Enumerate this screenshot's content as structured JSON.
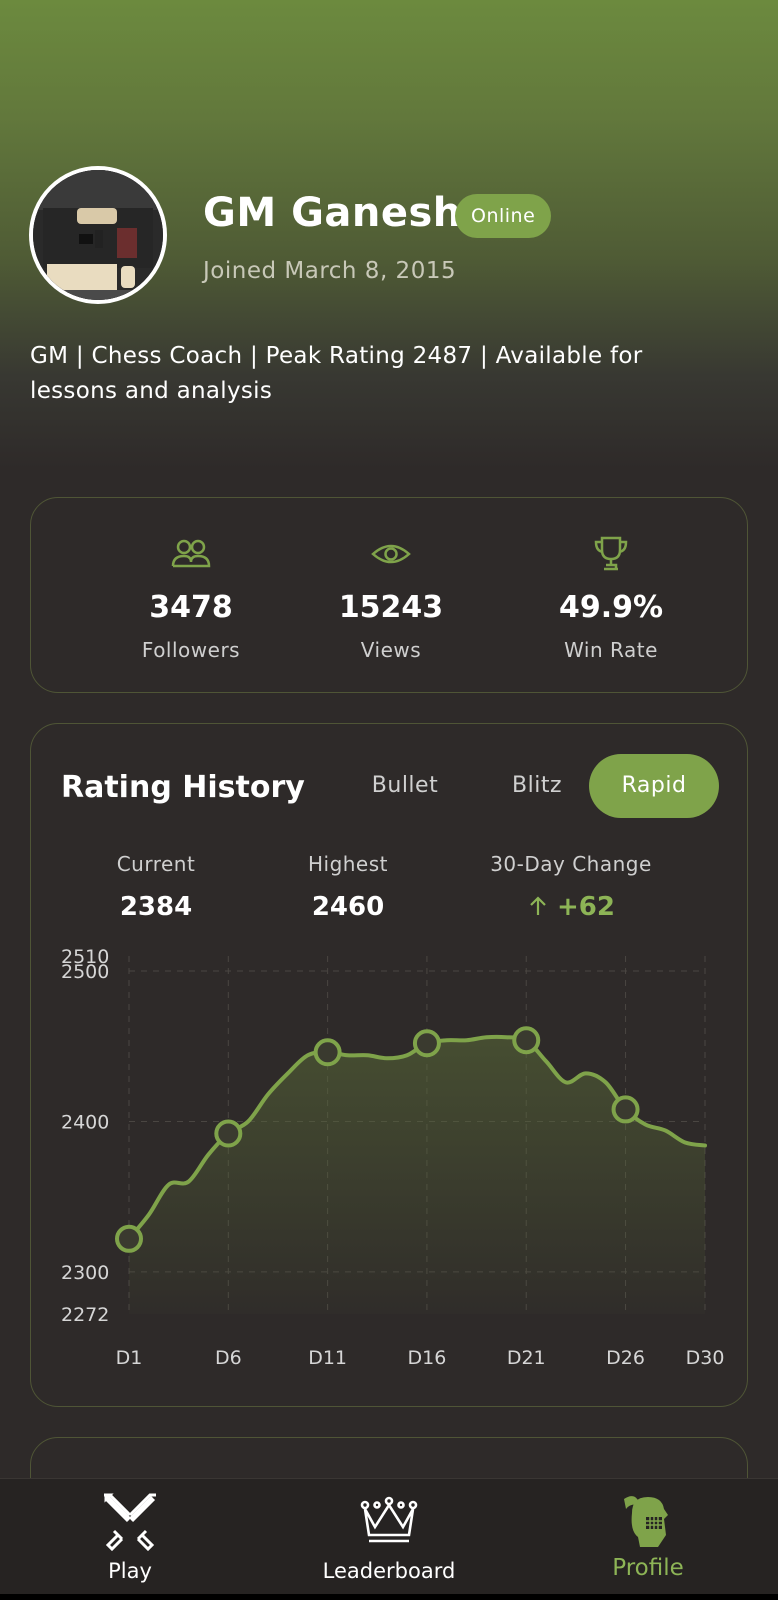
{
  "profile": {
    "name": "GM Ganesh",
    "status": "Online",
    "joined": "Joined March 8, 2015",
    "bio": "GM | Chess Coach | Peak Rating 2487 | Available for lessons and analysis"
  },
  "stats": [
    {
      "icon": "followers-icon",
      "value": "3478",
      "label": "Followers"
    },
    {
      "icon": "eye-icon",
      "value": "15243",
      "label": "Views"
    },
    {
      "icon": "trophy-icon",
      "value": "49.9%",
      "label": "Win Rate"
    }
  ],
  "rating_history": {
    "title": "Rating History",
    "tabs": [
      "Bullet",
      "Blitz",
      "Rapid"
    ],
    "active_tab": "Rapid",
    "metrics": [
      {
        "label": "Current",
        "value": "2384"
      },
      {
        "label": "Highest",
        "value": "2460"
      },
      {
        "label": "30-Day Change",
        "value": "+62"
      }
    ]
  },
  "chart_data": {
    "type": "area",
    "x": [
      "D1",
      "D2",
      "D3",
      "D4",
      "D5",
      "D6",
      "D7",
      "D8",
      "D9",
      "D10",
      "D11",
      "D12",
      "D13",
      "D14",
      "D15",
      "D16",
      "D17",
      "D18",
      "D19",
      "D20",
      "D21",
      "D22",
      "D23",
      "D24",
      "D25",
      "D26",
      "D27",
      "D28",
      "D29",
      "D30"
    ],
    "values": [
      2322,
      2338,
      2358,
      2360,
      2378,
      2392,
      2400,
      2418,
      2432,
      2444,
      2446,
      2444,
      2444,
      2442,
      2444,
      2452,
      2454,
      2454,
      2456,
      2456,
      2454,
      2440,
      2426,
      2432,
      2426,
      2408,
      2398,
      2394,
      2386,
      2384
    ],
    "markers": [
      "D1",
      "D6",
      "D11",
      "D16",
      "D21",
      "D26"
    ],
    "xtick_labels": [
      "D1",
      "D6",
      "D11",
      "D16",
      "D21",
      "D26",
      "D30"
    ],
    "ytick_labels": [
      "2510",
      "2500",
      "2400",
      "2300",
      "2272"
    ],
    "ylim": [
      2272,
      2510
    ],
    "grid": true,
    "colors": {
      "line": "#7fa34a",
      "fill_top": "#5a6b38"
    }
  },
  "nav": [
    {
      "icon": "crossed-swords-icon",
      "label": "Play"
    },
    {
      "icon": "crown-icon",
      "label": "Leaderboard"
    },
    {
      "icon": "knight-helmet-icon",
      "label": "Profile"
    }
  ],
  "colors": {
    "accent": "#7fa34a",
    "background": "#2e2a29"
  }
}
